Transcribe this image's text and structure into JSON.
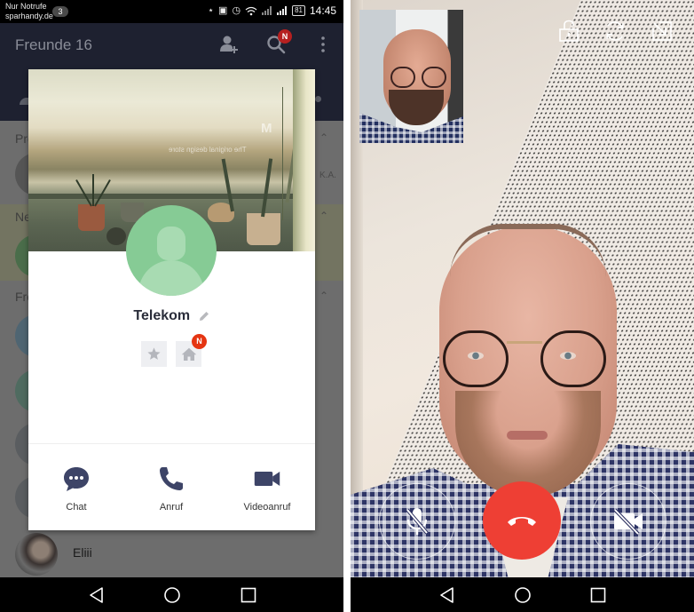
{
  "status_bar": {
    "carrier_line1": "Nur Notrufe",
    "carrier_line2": "sparhandy.de",
    "notification_count": "3",
    "battery": "81",
    "time": "14:45",
    "icons": [
      "bluetooth-icon",
      "nfc-icon",
      "alarm-icon",
      "wifi-icon",
      "signal-icon",
      "signal-icon"
    ]
  },
  "app_bar": {
    "title": "Freunde 16",
    "search_badge": "N",
    "actions": [
      "add-friend-icon",
      "search-icon",
      "more-vert-icon"
    ]
  },
  "friends_list": {
    "sections": [
      {
        "label": "Pro"
      },
      {
        "label": "Ne"
      },
      {
        "label": "Fre"
      }
    ],
    "partial_text": "K.A.",
    "visible_row": {
      "name": "Eliii"
    }
  },
  "profile_popup": {
    "cover_watermark_letter": "M",
    "cover_watermark_text": "The original design store",
    "contact_name": "Telekom",
    "home_badge": "N",
    "actions": [
      {
        "id": "chat",
        "label": "Chat",
        "icon": "chat-bubble-icon"
      },
      {
        "id": "call",
        "label": "Anruf",
        "icon": "phone-icon"
      },
      {
        "id": "video",
        "label": "Videoanruf",
        "icon": "video-camera-icon"
      }
    ],
    "colors": {
      "icon": "#3d4467",
      "avatar_bg": "#86cb95",
      "badge": "#e53512"
    }
  },
  "video_call": {
    "top_controls": [
      "lock-icon",
      "rotate-camera-icon",
      "minimize-icon"
    ],
    "bottom_controls": [
      {
        "id": "mute",
        "icon": "mic-off-icon"
      },
      {
        "id": "hangup",
        "icon": "hangup-icon"
      },
      {
        "id": "camera",
        "icon": "camera-off-icon"
      }
    ],
    "colors": {
      "hangup": "#ee3f34"
    }
  },
  "navigation": {
    "buttons": [
      "back",
      "home",
      "recents"
    ]
  }
}
